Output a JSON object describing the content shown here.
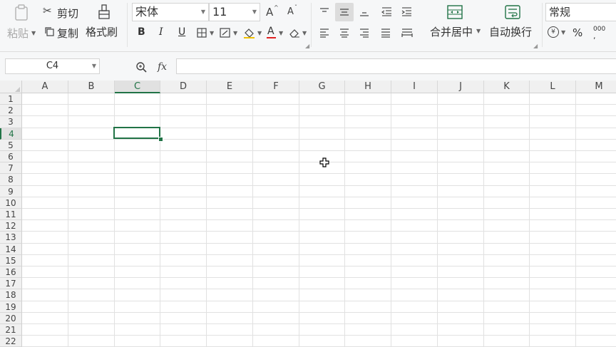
{
  "clipboard": {
    "paste": "粘贴",
    "cut": "剪切",
    "copy": "复制",
    "format_painter": "格式刷"
  },
  "font": {
    "name": "宋体",
    "size": "11",
    "grow": "A",
    "shrink": "A",
    "bold": "B",
    "italic": "I",
    "underline": "U",
    "font_color_letter": "A"
  },
  "alignment": {
    "merge_center": "合并居中",
    "wrap_text": "自动换行"
  },
  "number": {
    "format": "常规",
    "percent": "%",
    "thousands": "000"
  },
  "formula_bar": {
    "name_box": "C4",
    "fx": "fx",
    "formula": ""
  },
  "sheet": {
    "columns": [
      "A",
      "B",
      "C",
      "D",
      "E",
      "F",
      "G",
      "H",
      "I",
      "J",
      "K",
      "L",
      "M"
    ],
    "rows": [
      "1",
      "2",
      "3",
      "4",
      "5",
      "6",
      "7",
      "8",
      "9",
      "10",
      "11",
      "12",
      "13",
      "14",
      "15",
      "16",
      "17",
      "18",
      "19",
      "20",
      "21",
      "22"
    ],
    "active_cell": "C4",
    "active_column": "C",
    "active_row": "4"
  },
  "colors": {
    "accent_green": "#217346",
    "font_color_bar": "#e02020"
  }
}
